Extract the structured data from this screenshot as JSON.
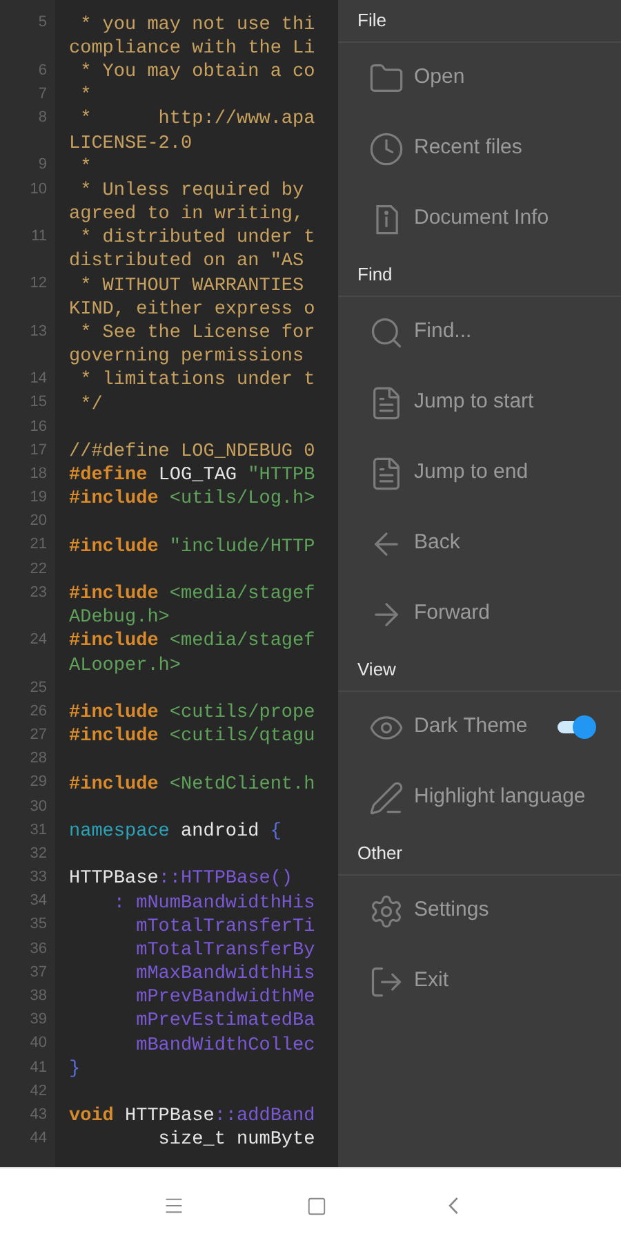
{
  "editor": {
    "rows": [
      {
        "number": "5",
        "tokens": [
          {
            "text": " * you may not use thi",
            "kind": "comment"
          }
        ]
      },
      {
        "tokens": [
          {
            "text": "compliance with the Li",
            "kind": "comment"
          }
        ]
      },
      {
        "number": "6",
        "tokens": [
          {
            "text": " * You may obtain a co",
            "kind": "comment"
          }
        ]
      },
      {
        "number": "7",
        "tokens": [
          {
            "text": " *",
            "kind": "comment"
          }
        ]
      },
      {
        "number": "8",
        "tokens": [
          {
            "text": " *      http://www.apa",
            "kind": "comment"
          }
        ]
      },
      {
        "tokens": [
          {
            "text": "LICENSE-2.0",
            "kind": "comment"
          }
        ]
      },
      {
        "number": "9",
        "tokens": [
          {
            "text": " *",
            "kind": "comment"
          }
        ]
      },
      {
        "number": "10",
        "tokens": [
          {
            "text": " * Unless required by",
            "kind": "comment"
          }
        ]
      },
      {
        "tokens": [
          {
            "text": "agreed to in writing,",
            "kind": "comment"
          }
        ]
      },
      {
        "number": "11",
        "tokens": [
          {
            "text": " * distributed under t",
            "kind": "comment"
          }
        ]
      },
      {
        "tokens": [
          {
            "text": "distributed on an \"AS",
            "kind": "comment"
          }
        ]
      },
      {
        "number": "12",
        "tokens": [
          {
            "text": " * WITHOUT WARRANTIES",
            "kind": "comment"
          }
        ]
      },
      {
        "tokens": [
          {
            "text": "KIND, either express o",
            "kind": "comment"
          }
        ]
      },
      {
        "number": "13",
        "tokens": [
          {
            "text": " * See the License for",
            "kind": "comment"
          }
        ]
      },
      {
        "tokens": [
          {
            "text": "governing permissions",
            "kind": "comment"
          }
        ]
      },
      {
        "number": "14",
        "tokens": [
          {
            "text": " * limitations under t",
            "kind": "comment"
          }
        ]
      },
      {
        "number": "15",
        "tokens": [
          {
            "text": " */",
            "kind": "comment"
          }
        ]
      },
      {
        "number": "16"
      },
      {
        "number": "17",
        "tokens": [
          {
            "text": "//#define LOG_NDEBUG 0",
            "kind": "comment"
          }
        ]
      },
      {
        "number": "18",
        "tokens": [
          {
            "text": "#define",
            "kind": "keyword"
          },
          {
            "text": " LOG_TAG ",
            "kind": "plain"
          },
          {
            "text": "\"HTTPB",
            "kind": "string"
          }
        ]
      },
      {
        "number": "19",
        "tokens": [
          {
            "text": "#include",
            "kind": "keyword"
          },
          {
            "text": " <utils/Log.h>",
            "kind": "string"
          }
        ]
      },
      {
        "number": "20"
      },
      {
        "number": "21",
        "tokens": [
          {
            "text": "#include",
            "kind": "keyword"
          },
          {
            "text": " \"include/HTTP",
            "kind": "string"
          }
        ]
      },
      {
        "number": "22"
      },
      {
        "number": "23",
        "tokens": [
          {
            "text": "#include",
            "kind": "keyword"
          },
          {
            "text": " <media/stagef",
            "kind": "string"
          }
        ]
      },
      {
        "tokens": [
          {
            "text": "ADebug.h>",
            "kind": "string"
          }
        ]
      },
      {
        "number": "24",
        "tokens": [
          {
            "text": "#include",
            "kind": "keyword"
          },
          {
            "text": " <media/stagef",
            "kind": "string"
          }
        ]
      },
      {
        "tokens": [
          {
            "text": "ALooper.h>",
            "kind": "string"
          }
        ]
      },
      {
        "number": "25"
      },
      {
        "number": "26",
        "tokens": [
          {
            "text": "#include",
            "kind": "keyword"
          },
          {
            "text": " <cutils/prope",
            "kind": "string"
          }
        ]
      },
      {
        "number": "27",
        "tokens": [
          {
            "text": "#include",
            "kind": "keyword"
          },
          {
            "text": " <cutils/qtagu",
            "kind": "string"
          }
        ]
      },
      {
        "number": "28"
      },
      {
        "number": "29",
        "tokens": [
          {
            "text": "#include",
            "kind": "keyword"
          },
          {
            "text": " <NetdClient.h",
            "kind": "string"
          }
        ]
      },
      {
        "number": "30"
      },
      {
        "number": "31",
        "tokens": [
          {
            "text": "namespace",
            "kind": "type"
          },
          {
            "text": " android ",
            "kind": "plain"
          },
          {
            "text": "{",
            "kind": "punct"
          }
        ]
      },
      {
        "number": "32"
      },
      {
        "number": "33",
        "tokens": [
          {
            "text": "HTTPBase",
            "kind": "plain"
          },
          {
            "text": "::HTTPBase()",
            "kind": "member"
          }
        ]
      },
      {
        "number": "34",
        "tokens": [
          {
            "text": "    : mNumBandwidthHis",
            "kind": "member"
          }
        ]
      },
      {
        "number": "35",
        "tokens": [
          {
            "text": "      mTotalTransferTi",
            "kind": "member"
          }
        ]
      },
      {
        "number": "36",
        "tokens": [
          {
            "text": "      mTotalTransferBy",
            "kind": "member"
          }
        ]
      },
      {
        "number": "37",
        "tokens": [
          {
            "text": "      mMaxBandwidthHis",
            "kind": "member"
          }
        ]
      },
      {
        "number": "38",
        "tokens": [
          {
            "text": "      mPrevBandwidthMe",
            "kind": "member"
          }
        ]
      },
      {
        "number": "39",
        "tokens": [
          {
            "text": "      mPrevEstimatedBa",
            "kind": "member"
          }
        ]
      },
      {
        "number": "40",
        "tokens": [
          {
            "text": "      mBandWidthCollec",
            "kind": "member"
          }
        ]
      },
      {
        "number": "41",
        "tokens": [
          {
            "text": "}",
            "kind": "punct"
          }
        ]
      },
      {
        "number": "42"
      },
      {
        "number": "43",
        "tokens": [
          {
            "text": "void",
            "kind": "keyword"
          },
          {
            "text": " HTTPBase",
            "kind": "plain"
          },
          {
            "text": "::addBand",
            "kind": "member"
          }
        ]
      },
      {
        "number": "44",
        "tokens": [
          {
            "text": "        size_t numByte",
            "kind": "plain"
          }
        ]
      }
    ]
  },
  "menu": {
    "sections": [
      {
        "title": "File",
        "items": [
          {
            "label": "Open",
            "kind": "action"
          },
          {
            "label": "Recent files",
            "kind": "action"
          },
          {
            "label": "Document Info",
            "kind": "action"
          }
        ]
      },
      {
        "title": "Find",
        "items": [
          {
            "label": "Find...",
            "kind": "action"
          },
          {
            "label": "Jump to start",
            "kind": "action"
          },
          {
            "label": "Jump to end",
            "kind": "action"
          },
          {
            "label": "Back",
            "kind": "action"
          },
          {
            "label": "Forward",
            "kind": "action"
          }
        ]
      },
      {
        "title": "View",
        "items": [
          {
            "label": "Dark Theme",
            "kind": "toggle",
            "on": true
          },
          {
            "label": "Highlight language",
            "kind": "action"
          }
        ]
      },
      {
        "title": "Other",
        "items": [
          {
            "label": "Settings",
            "kind": "action"
          },
          {
            "label": "Exit",
            "kind": "action"
          }
        ]
      }
    ]
  }
}
